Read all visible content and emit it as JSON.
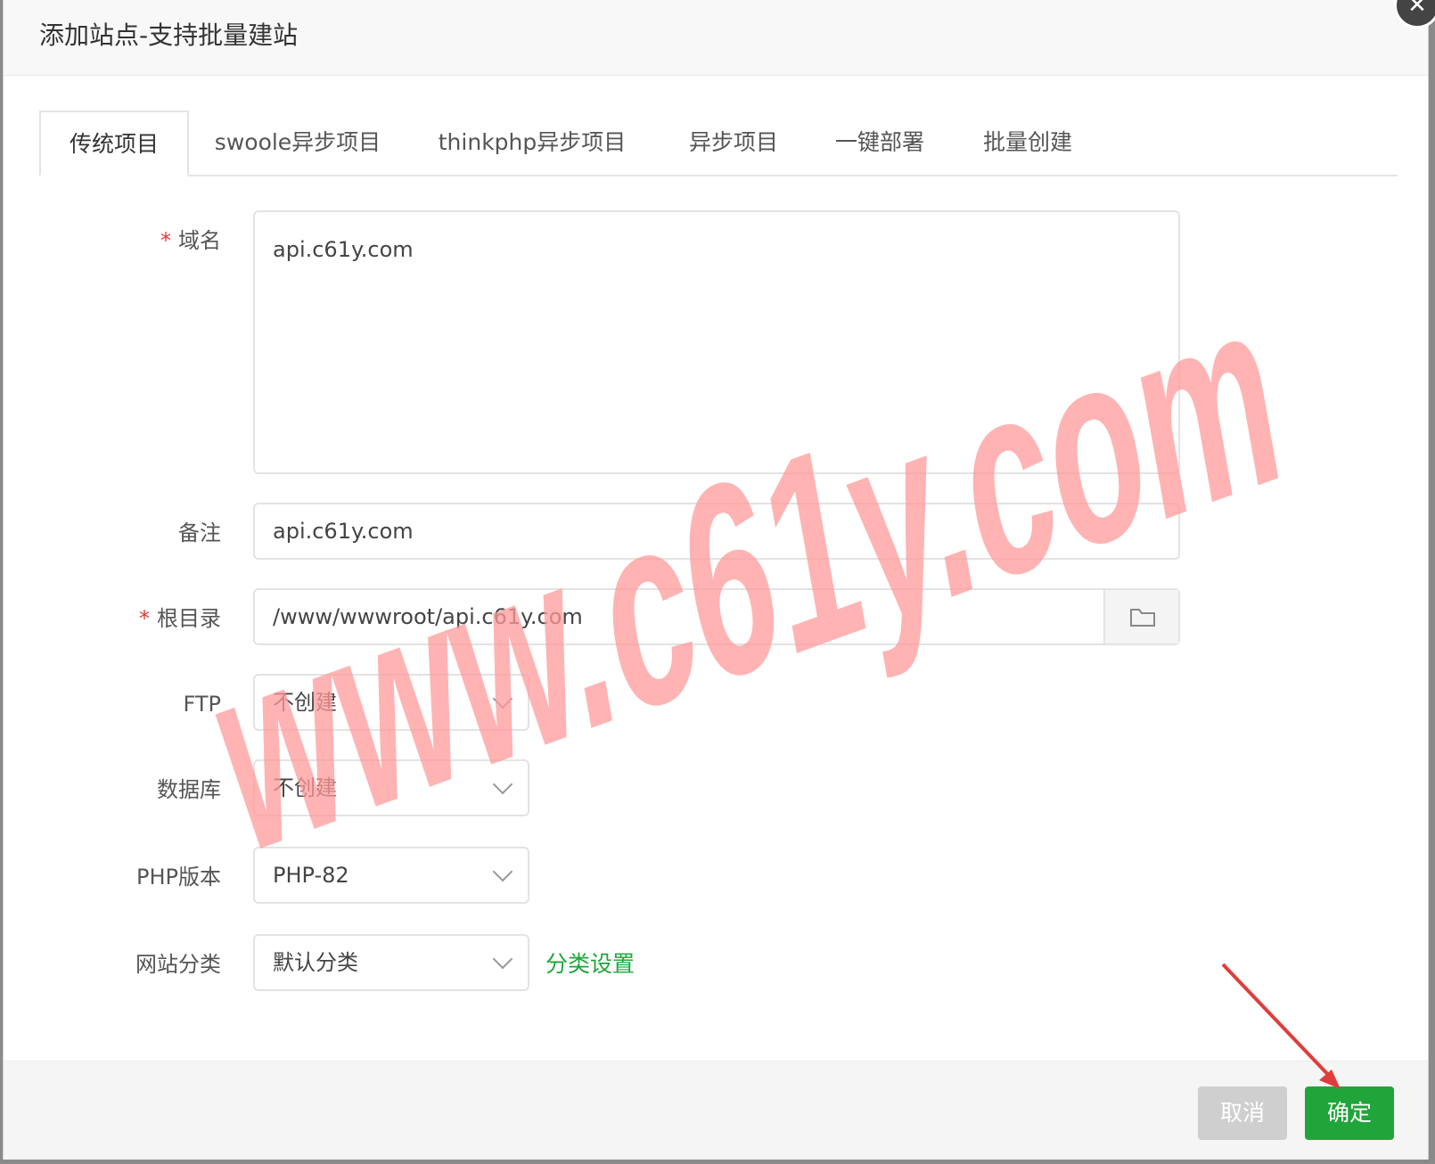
{
  "dialog": {
    "title": "添加站点-支持批量建站",
    "close_icon": "close-icon"
  },
  "tabs": [
    {
      "label": "传统项目",
      "active": true
    },
    {
      "label": "swoole异步项目",
      "active": false
    },
    {
      "label": "thinkphp异步项目",
      "active": false
    },
    {
      "label": "异步项目",
      "active": false
    },
    {
      "label": "一键部署",
      "active": false
    },
    {
      "label": "批量创建",
      "active": false
    }
  ],
  "form": {
    "domain": {
      "label": "域名",
      "required_mark": "*",
      "value": "api.c61y.com"
    },
    "remark": {
      "label": "备注",
      "value": "api.c61y.com"
    },
    "root_dir": {
      "label": "根目录",
      "required_mark": "*",
      "value": "/www/wwwroot/api.c61y.com",
      "button_icon": "folder-icon"
    },
    "ftp": {
      "label": "FTP",
      "value": "不创建"
    },
    "database": {
      "label": "数据库",
      "value": "不创建"
    },
    "php_version": {
      "label": "PHP版本",
      "value": "PHP-82"
    },
    "site_category": {
      "label": "网站分类",
      "value": "默认分类",
      "settings_link": "分类设置"
    }
  },
  "footer": {
    "cancel_label": "取消",
    "ok_label": "确定"
  },
  "watermark": {
    "text": "www.c61y.com",
    "color": "#ff9999"
  },
  "colors": {
    "accent": "#20a53a",
    "required": "#e4393c",
    "arrow": "#e03c3c"
  }
}
